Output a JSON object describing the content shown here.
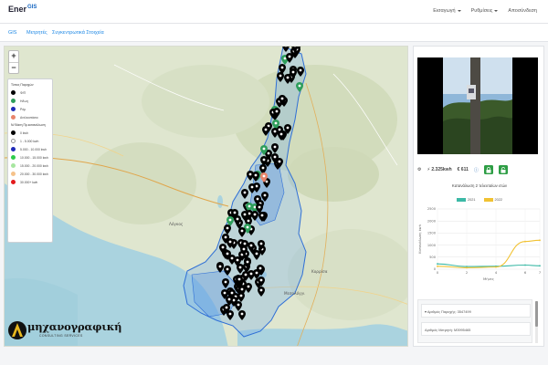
{
  "header": {
    "logo_text": "Ener",
    "logo_sup": "GIS",
    "nav": [
      {
        "label": "Εισαγωγή",
        "has_caret": true
      },
      {
        "label": "Ρυθμίσεις",
        "has_caret": true
      },
      {
        "label": "Αποσύνδεση",
        "has_caret": false
      }
    ]
  },
  "tabs": [
    {
      "label": "GIS"
    },
    {
      "label": "Μετρητές"
    },
    {
      "label": "Συγκεντρωτικά Στοιχεία"
    }
  ],
  "map": {
    "zoom_in": "+",
    "zoom_out": "−",
    "legend": {
      "title_type": "Τύπος Παροχών",
      "types": [
        {
          "label": "Φ/Π",
          "color": "#000000"
        },
        {
          "label": "Η/Ιωη",
          "color": "#2e9e5b"
        },
        {
          "label": "Ρόμ",
          "color": "#1f2bb8"
        },
        {
          "label": "Αντλιοστάσιο",
          "color": "#e8846b"
        }
      ],
      "title_range": "Ν/ Βάση Πρ.κατανάλωση",
      "ranges": [
        {
          "label": "0 kwh",
          "color": "#000000"
        },
        {
          "label": "1 - 5.000 kwh",
          "color": "#ffffff"
        },
        {
          "label": "5.000 - 10.000 kwh",
          "color": "#1f2bb8"
        },
        {
          "label": "10.000 - 15.000 kwh",
          "color": "#2ecc4a"
        },
        {
          "label": "15.000 - 20.000 kwh",
          "color": "#a7e6a0"
        },
        {
          "label": "20.000 - 30.000 kwh",
          "color": "#f5c28a"
        },
        {
          "label": "30.000+ kwh",
          "color": "#e31a1c"
        }
      ]
    },
    "brand": {
      "name": "μηχανογραφική",
      "sub": "CONSULTING SERVICES"
    },
    "labels": [
      {
        "text": "Λόγκος"
      },
      {
        "text": "Κορρίσα"
      },
      {
        "text": "Μεσολόγγι"
      }
    ]
  },
  "side": {
    "stats": {
      "power": "2.325kwh",
      "cost": "€ 611"
    },
    "chart_data": {
      "type": "line",
      "title": "Κατανάλωση 2 τελευταίων ετών",
      "xlabel": "Μήνες",
      "ylabel": "Κατανάλωση kwh",
      "x": [
        0,
        2,
        4,
        6,
        7
      ],
      "xticks": [
        "0",
        "2",
        "4",
        "6",
        "7"
      ],
      "ylim": [
        0,
        2500
      ],
      "yticks": [
        "0",
        "500",
        "1000",
        "1500",
        "2000",
        "2500"
      ],
      "series": [
        {
          "name": "2021",
          "color": "#3cb9a6",
          "values": [
            220,
            110,
            120,
            170,
            140
          ]
        },
        {
          "name": "2022",
          "color": "#f1c232",
          "values": [
            120,
            60,
            90,
            1150,
            1200
          ]
        }
      ]
    },
    "info": {
      "line1": "Αριθμός Παροχής: 3547499",
      "line2": "Αριθμός Μετρητή: M3995465"
    }
  }
}
